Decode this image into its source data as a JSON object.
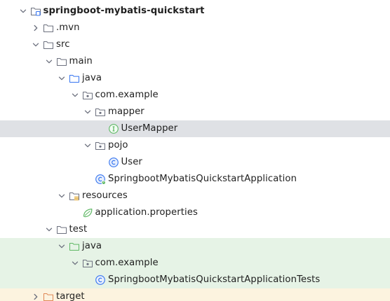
{
  "colors": {
    "selected_row": "#dfe1e5",
    "test_row": "#e6f3e6",
    "excluded_row": "#fcf3df",
    "source_folder_icon": "#3574f0",
    "test_folder_icon": "#5fb865",
    "excluded_folder_icon": "#e08855",
    "class_icon": "#3574f0",
    "interface_icon": "#5fb865"
  },
  "project_tree": {
    "items": [
      {
        "label": "springboot-mybatis-quickstart",
        "depth": 0,
        "chevron": "down",
        "icon": "module-folder-icon",
        "bold": true,
        "highlight": "none"
      },
      {
        "label": ".mvn",
        "depth": 1,
        "chevron": "right",
        "icon": "folder-icon",
        "bold": false,
        "highlight": "none"
      },
      {
        "label": "src",
        "depth": 1,
        "chevron": "down",
        "icon": "folder-icon",
        "bold": false,
        "highlight": "none"
      },
      {
        "label": "main",
        "depth": 2,
        "chevron": "down",
        "icon": "folder-icon",
        "bold": false,
        "highlight": "none"
      },
      {
        "label": "java",
        "depth": 3,
        "chevron": "down",
        "icon": "source-folder-icon",
        "bold": false,
        "highlight": "none"
      },
      {
        "label": "com.example",
        "depth": 4,
        "chevron": "down",
        "icon": "package-icon",
        "bold": false,
        "highlight": "none"
      },
      {
        "label": "mapper",
        "depth": 5,
        "chevron": "down",
        "icon": "package-icon",
        "bold": false,
        "highlight": "none"
      },
      {
        "label": "UserMapper",
        "depth": 6,
        "chevron": "none",
        "icon": "interface-icon",
        "bold": false,
        "highlight": "selected"
      },
      {
        "label": "pojo",
        "depth": 5,
        "chevron": "down",
        "icon": "package-icon",
        "bold": false,
        "highlight": "none"
      },
      {
        "label": "User",
        "depth": 6,
        "chevron": "none",
        "icon": "class-icon",
        "bold": false,
        "highlight": "none"
      },
      {
        "label": "SpringbootMybatisQuickstartApplication",
        "depth": 5,
        "chevron": "none",
        "icon": "spring-boot-class-icon",
        "bold": false,
        "highlight": "none"
      },
      {
        "label": "resources",
        "depth": 3,
        "chevron": "down",
        "icon": "resources-folder-icon",
        "bold": false,
        "highlight": "none"
      },
      {
        "label": "application.properties",
        "depth": 4,
        "chevron": "none",
        "icon": "spring-properties-icon",
        "bold": false,
        "highlight": "none"
      },
      {
        "label": "test",
        "depth": 2,
        "chevron": "down",
        "icon": "folder-icon",
        "bold": false,
        "highlight": "none"
      },
      {
        "label": "java",
        "depth": 3,
        "chevron": "down",
        "icon": "test-folder-icon",
        "bold": false,
        "highlight": "test"
      },
      {
        "label": "com.example",
        "depth": 4,
        "chevron": "down",
        "icon": "package-icon",
        "bold": false,
        "highlight": "test"
      },
      {
        "label": "SpringbootMybatisQuickstartApplicationTests",
        "depth": 5,
        "chevron": "none",
        "icon": "class-icon",
        "bold": false,
        "highlight": "test"
      },
      {
        "label": "target",
        "depth": 1,
        "chevron": "right",
        "icon": "excluded-folder-icon",
        "bold": false,
        "highlight": "excluded"
      }
    ]
  }
}
